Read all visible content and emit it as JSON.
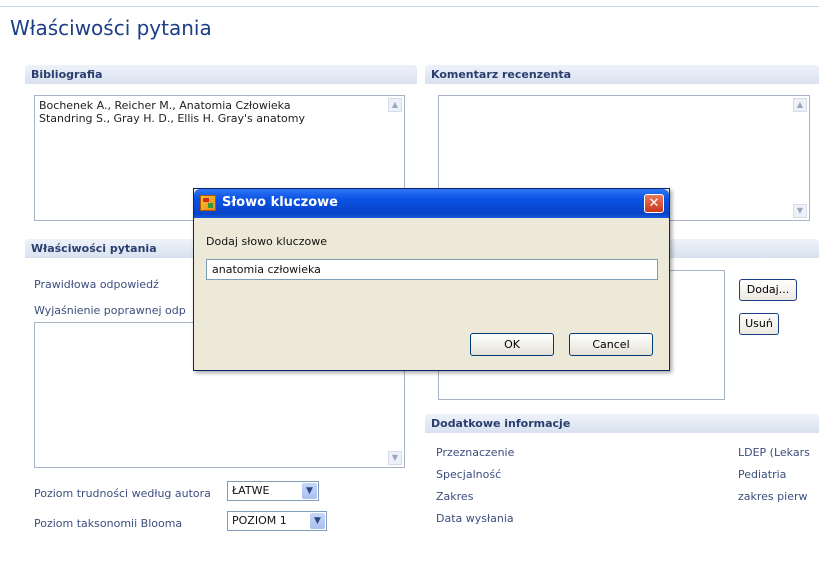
{
  "page_title": "Właściwości pytania",
  "bibliography": {
    "header": "Bibliografia",
    "lines": [
      "Bochenek A., Reicher M., Anatomia Człowieka",
      "Standring S., Gray H. D., Ellis H. Gray's anatomy"
    ]
  },
  "reviewer_comment": {
    "header": "Komentarz recenzenta",
    "text": ""
  },
  "question_props": {
    "header": "Właściwości pytania",
    "correct_answer_label": "Prawidłowa odpowiedź",
    "explanation_label": "Wyjaśnienie poprawnej odp",
    "difficulty_label": "Poziom trudności według autora",
    "difficulty_value": "ŁATWE",
    "taxonomy_label": "Poziom taksonomii Blooma",
    "taxonomy_value": "POZIOM 1"
  },
  "keywords": {
    "add_button": "Dodaj...",
    "remove_button": "Usuń"
  },
  "additional_info": {
    "header": "Dodatkowe informacje",
    "rows": [
      {
        "label": "Przeznaczenie",
        "value": "LDEP (Lekars"
      },
      {
        "label": "Specjalność",
        "value": "Pediatria"
      },
      {
        "label": "Zakres",
        "value": "zakres pierw"
      },
      {
        "label": "Data wysłania",
        "value": ""
      }
    ]
  },
  "dialog": {
    "title": "Słowo kluczowe",
    "prompt": "Dodaj słowo kluczowe",
    "input_value": "anatomia człowieka",
    "ok_label": "OK",
    "cancel_label": "Cancel"
  },
  "icons": {
    "scroll_up": "▲",
    "scroll_down": "▼",
    "dropdown": "▼",
    "close": "✕"
  },
  "colors": {
    "title": "#1c3d87",
    "titlebar": "#0a52e3",
    "close": "#c8391a"
  }
}
